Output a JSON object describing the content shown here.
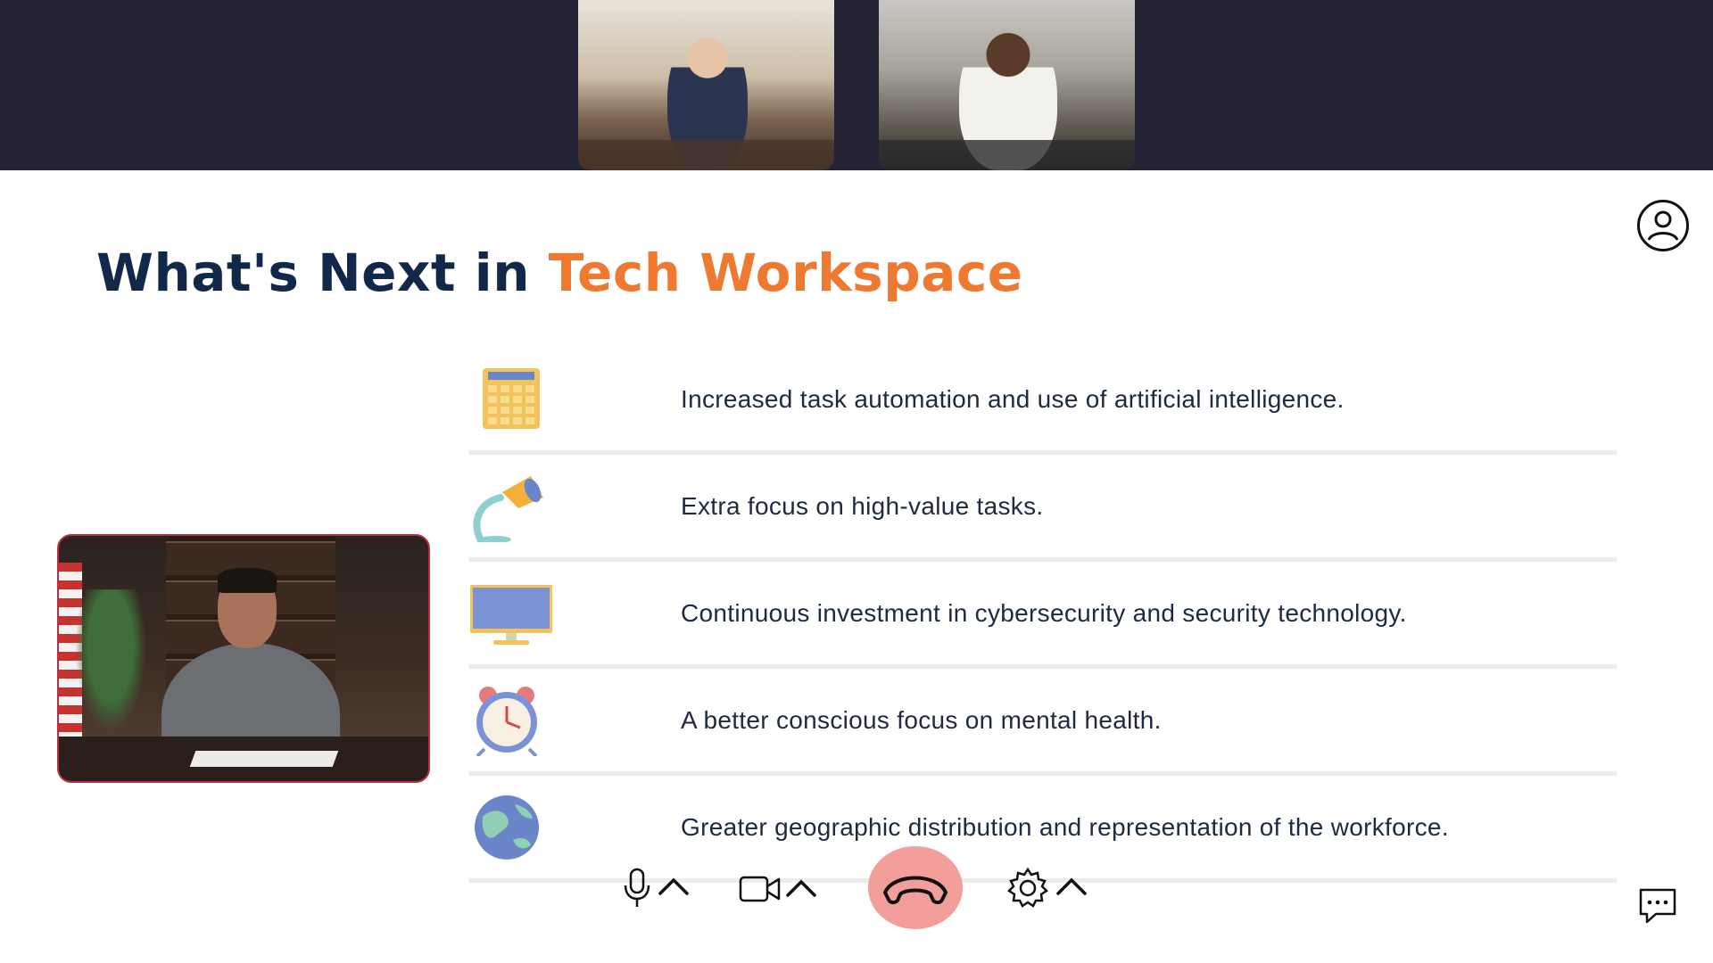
{
  "slide": {
    "title_part1": "What's Next in ",
    "title_part2": "Tech Workspace",
    "title_color": "#12284a",
    "accent_color": "#ee7a32"
  },
  "items": [
    {
      "icon": "calculator-icon",
      "text": "Increased task automation and use of artificial intelligence."
    },
    {
      "icon": "desk-lamp-icon",
      "text": "Extra focus on high-value tasks."
    },
    {
      "icon": "monitor-icon",
      "text": "Continuous investment in cybersecurity and security technology."
    },
    {
      "icon": "alarm-clock-icon",
      "text": "A better conscious focus on mental health."
    },
    {
      "icon": "globe-icon",
      "text": "Greater geographic distribution and representation of the workforce."
    }
  ],
  "participants": [
    {
      "name": "participant-video-elderly-man"
    },
    {
      "name": "participant-video-woman"
    }
  ],
  "presenter": {
    "name": "presenter-video"
  },
  "toolbar": {
    "mic": "microphone-icon",
    "camera": "video-camera-icon",
    "end_call": "end-call-icon",
    "settings": "gear-icon",
    "end_call_color": "#f29f9c"
  },
  "colors": {
    "topbar": "#232335",
    "text": "#1d2b3f",
    "separator": "#ececec"
  }
}
